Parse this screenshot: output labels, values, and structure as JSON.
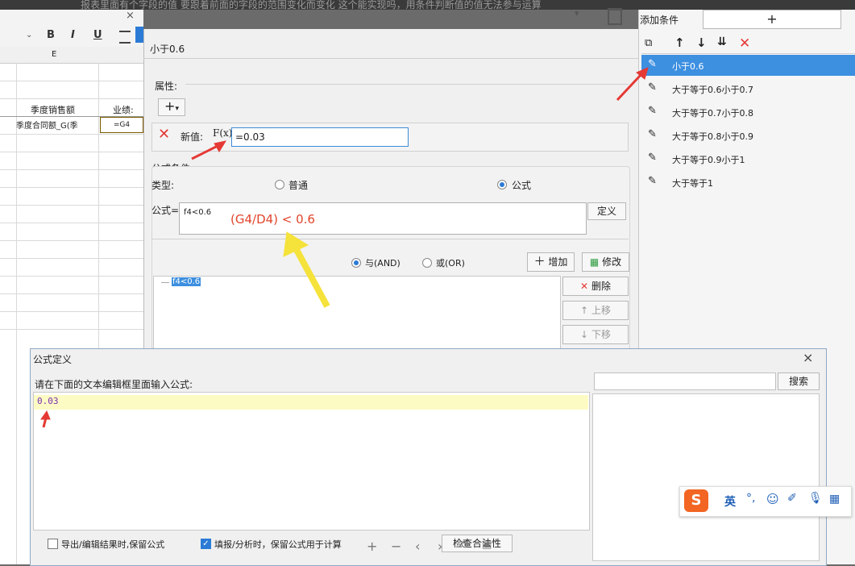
{
  "top_banner": "报表里面有个字段的值 要跟着前面的字段的范围变化而变化 这个能实现吗，用条件判断值的值无法参与运算",
  "spreadsheet": {
    "close_glyph": "×",
    "toolbar": {
      "bold": "B",
      "italic": "I",
      "underline": "U"
    },
    "col_header": "E",
    "header_cell_1": "季度销售额",
    "header_cell_2": "业绩:",
    "data_cell_1": "季度合同额_G(季",
    "data_cell_2": "=G4"
  },
  "prop_dialog": {
    "title": "小于0.6",
    "section_attr": "属性:",
    "add_glyph": "+",
    "newvalue_label": "新值:",
    "fx_label": "F(x)",
    "newvalue_input": "=0.03",
    "section_formula": "公式条件",
    "type_label": "类型:",
    "type_normal": "普通",
    "type_formula": "公式",
    "formula_label": "公式=",
    "formula_text": "f4<0.6",
    "annotation": "(G4/D4) < 0.6",
    "define_btn": "定义",
    "and_label": "与(AND)",
    "or_label": "或(OR)",
    "add_btn": "增加",
    "modify_btn": "修改",
    "tree_item": "f4<0.6",
    "delete_btn": "删除",
    "up_btn": "上移",
    "down_btn": "下移"
  },
  "right_panel": {
    "add_condition_label": "添加条件",
    "add_glyph": "+",
    "conditions": [
      "小于0.6",
      "大于等于0.6小于0.7",
      "大于等于0.7小于0.8",
      "大于等于0.8小于0.9",
      "大于等于0.9小于1",
      "大于等于1"
    ]
  },
  "formula_dialog": {
    "title": "公式定义",
    "close_glyph": "×",
    "prompt": "请在下面的文本编辑框里面输入公式:",
    "editor_value": "0.03",
    "search_btn": "搜索",
    "keep_formula_export": "导出/编辑结果时,保留公式",
    "keep_formula_fill": "填报/分析时，保留公式用于计算",
    "check_btn": "检查合法性"
  },
  "ime_toolbar": {
    "logo": "S",
    "lang": "英"
  },
  "colors": {
    "selection": "#3d8fe0",
    "red_arrow": "#e53935",
    "yellow_arrow": "#f5e23a",
    "highlight_row": "#fdfbc4"
  }
}
